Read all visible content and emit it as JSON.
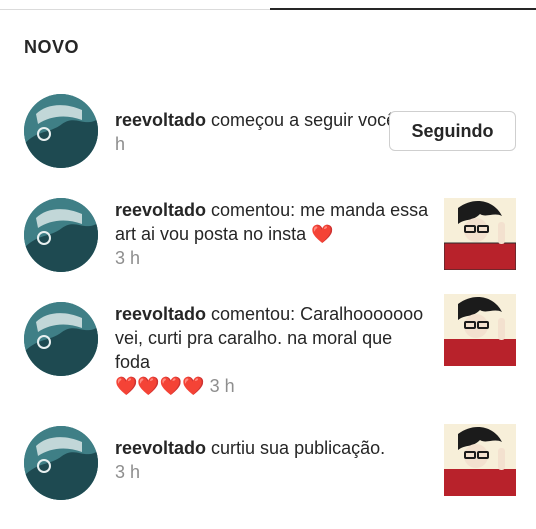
{
  "section": {
    "title": "NOVO"
  },
  "notifications": [
    {
      "username": "reevoltado",
      "text": " começou a seguir você.",
      "time": "3 h",
      "button": "Seguindo"
    },
    {
      "username": "reevoltado",
      "text": " comentou: me manda essa art ai vou posta no insta ",
      "emoji": "❤️",
      "time": "3 h"
    },
    {
      "username": "reevoltado",
      "text": " comentou: Caralhooooooo vei, curti pra caralho. na moral que foda ",
      "emoji": "❤️❤️❤️❤️",
      "time": "3 h"
    },
    {
      "username": "reevoltado",
      "text": " curtiu sua publicação.",
      "time": "3 h"
    }
  ],
  "icons": {
    "avatar": "profile-avatar",
    "thumbnail": "post-thumbnail",
    "heart": "heart-emoji"
  },
  "colors": {
    "accent": "#262626",
    "muted": "#8e8e8e",
    "heart": "#e0192b"
  }
}
